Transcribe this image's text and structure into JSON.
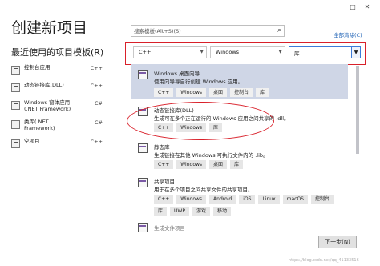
{
  "window": {
    "controls": [
      "□",
      "✕"
    ]
  },
  "title": "创建新项目",
  "recent": {
    "title": "最近使用的项目模板(R)",
    "items": [
      {
        "label": "控制台应用",
        "lang": "C++"
      },
      {
        "label": "动态链接库(DLL)",
        "lang": "C++"
      },
      {
        "label": "Windows 窗体应用(.NET Framework)",
        "lang": "C#"
      },
      {
        "label": "类库(.NET Framework)",
        "lang": "C#"
      },
      {
        "label": "空项目",
        "lang": "C++"
      }
    ]
  },
  "search": {
    "placeholder": "搜索模板(Alt+S)(S)",
    "icon": "search-icon"
  },
  "clear_all": "全部清除(C)",
  "filters": {
    "language": "C++",
    "platform": "Windows",
    "project_type": "库"
  },
  "templates": [
    {
      "name": "Windows 桌面向导",
      "desc": "使用向导导自行创建 Windows 应用。",
      "tags": [
        "C++",
        "Windows",
        "桌面",
        "控制台",
        "库"
      ],
      "selected": true
    },
    {
      "name": "动态链接库(DLL)",
      "desc": "生成可在多个正在运行的 Windows 应用之间共享的 .dll。",
      "tags": [
        "C++",
        "Windows",
        "库"
      ],
      "selected": false
    },
    {
      "name": "静态库",
      "desc": "生成链接在其他 Windows 可执行文件内的 .lib。",
      "tags": [
        "C++",
        "Windows",
        "桌面",
        "库"
      ],
      "selected": false
    },
    {
      "name": "共享项目",
      "desc": "用于在多个项目之间共享文件的共享项目。",
      "tags": [
        "C++",
        "Windows",
        "Android",
        "iOS",
        "Linux",
        "macOS",
        "控制台",
        "库",
        "UWP",
        "游戏",
        "移动"
      ],
      "selected": false
    },
    {
      "name": "生成文件项目",
      "desc": "",
      "tags": [],
      "selected": false
    }
  ],
  "next_button": "下一步(N)",
  "watermark": "https://blog.csdn.net/qq_41133516",
  "colors": {
    "highlight": "#d9202a",
    "selected_row": "#cfd6e6",
    "link": "#1a5fb4"
  }
}
